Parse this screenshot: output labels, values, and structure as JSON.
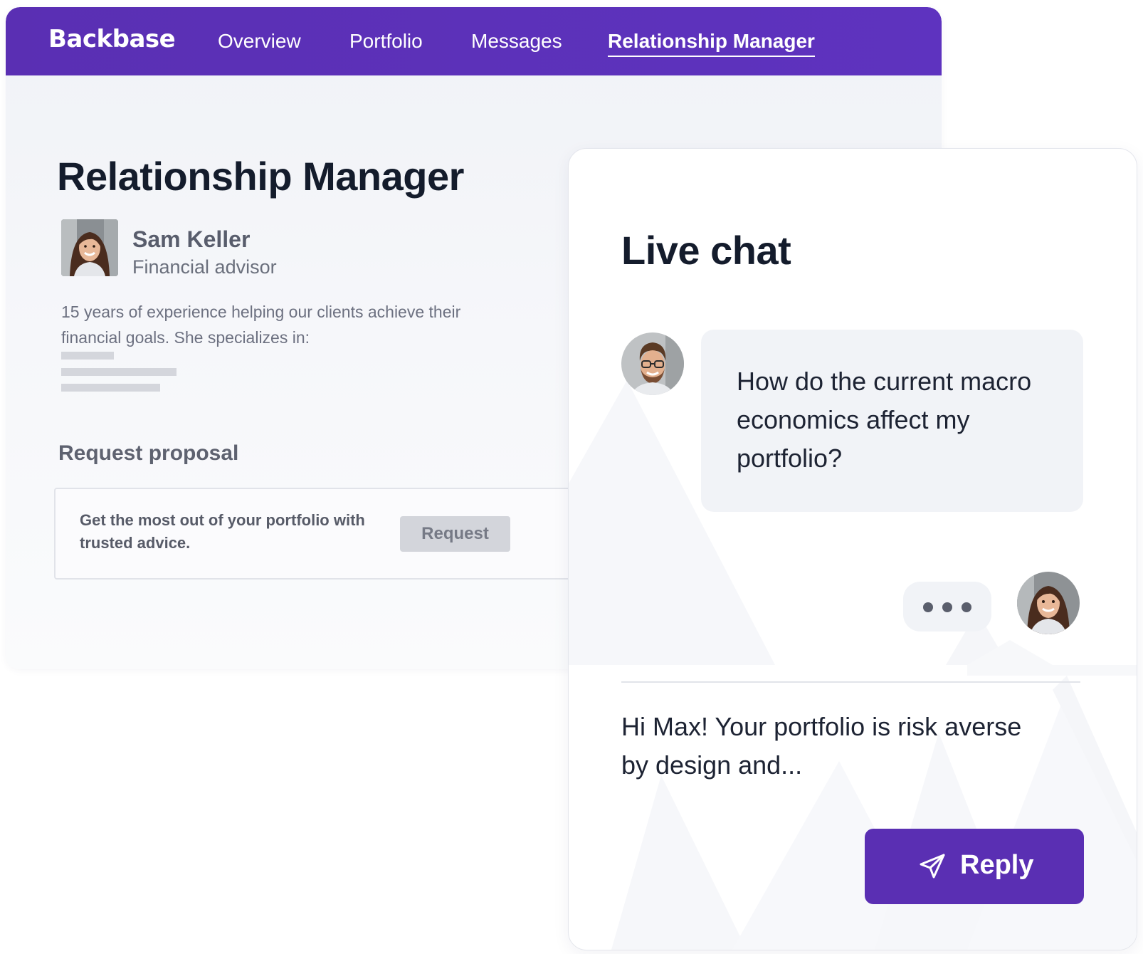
{
  "navbar": {
    "logo": "Backbase",
    "items": [
      {
        "label": "Overview"
      },
      {
        "label": "Portfolio"
      },
      {
        "label": "Messages"
      },
      {
        "label": "Relationship Manager"
      }
    ],
    "active_item": "Relationship Manager"
  },
  "page": {
    "title": "Relationship Manager",
    "advisor": {
      "name": "Sam Keller",
      "role": "Financial advisor",
      "bio": "15 years of experience helping our clients achieve their financial goals. She specializes in:"
    },
    "proposal": {
      "section_title": "Request proposal",
      "text": "Get the most out of your portfolio with trusted advice.",
      "button_label": "Request"
    }
  },
  "chat": {
    "title": "Live chat",
    "incoming_message": "How do the current macro economics affect my portfolio?",
    "reply_preview": "Hi Max! Your portfolio is risk averse by design and...",
    "reply_button_label": "Reply"
  },
  "colors": {
    "brand_purple": "#5a2fb3",
    "title_text": "#141c2c",
    "bubble_bg": "#f1f3f7"
  },
  "icons": {
    "reply": "paper-plane-icon",
    "typing": "typing-indicator-dots"
  }
}
